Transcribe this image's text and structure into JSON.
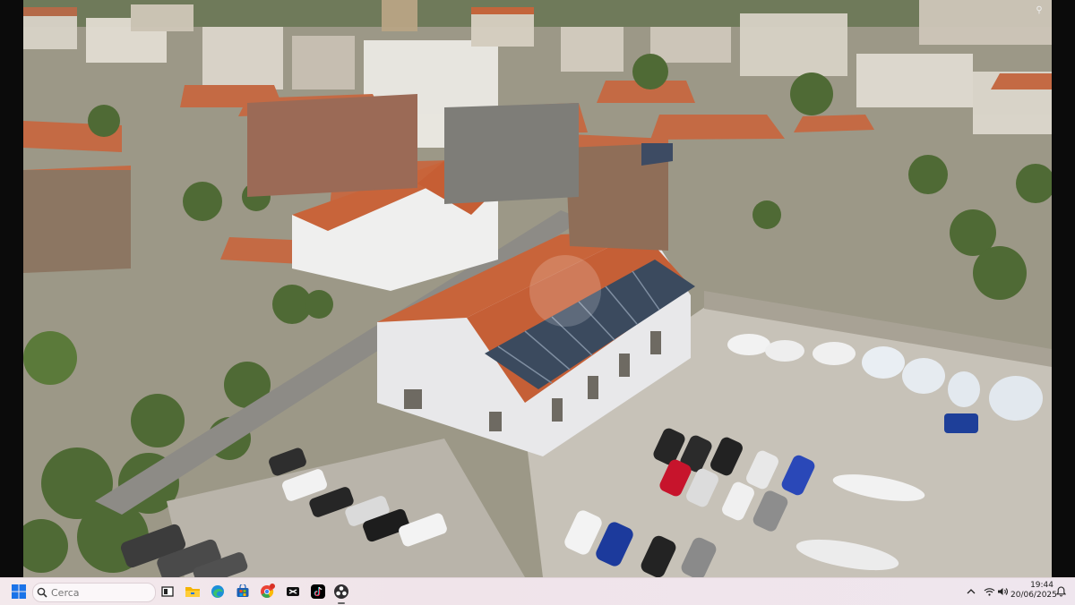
{
  "viewer": {
    "photo_description_name": "aerial-town-photo"
  },
  "taskbar": {
    "search_placeholder": "Cerca",
    "apps": [
      {
        "name": "task-view",
        "icon": "task-view-icon"
      },
      {
        "name": "file-explorer",
        "icon": "folder-icon"
      },
      {
        "name": "edge",
        "icon": "edge-icon"
      },
      {
        "name": "store",
        "icon": "store-icon"
      },
      {
        "name": "chrome",
        "icon": "chrome-icon",
        "badge": true
      },
      {
        "name": "capcut",
        "icon": "capcut-icon"
      },
      {
        "name": "tiktok",
        "icon": "tiktok-icon"
      },
      {
        "name": "obs",
        "icon": "obs-icon",
        "active": true
      }
    ],
    "time": "19:44",
    "date": "20/06/2025"
  },
  "colors": {
    "taskbar_bg": "#f1e6eb",
    "windows_blue": "#1a73e8",
    "roof_terracotta": "#c8643a",
    "solar_panel": "#3b4a5e"
  }
}
